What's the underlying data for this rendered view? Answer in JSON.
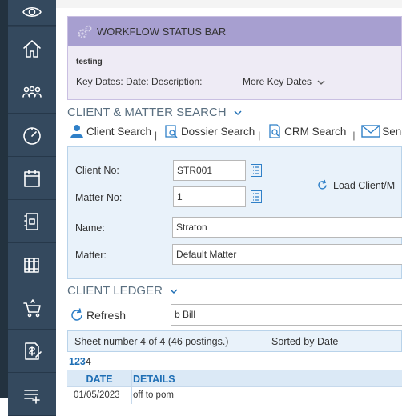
{
  "workflow": {
    "title": "WORKFLOW STATUS BAR",
    "subtitle": "testing",
    "key_dates": "Key Dates: Date:  Description:",
    "more_key_dates": "More Key Dates"
  },
  "client_search": {
    "title": "CLIENT & MATTER SEARCH",
    "links": [
      {
        "label": "Client Search",
        "icon": "person-icon"
      },
      {
        "label": "Dossier Search",
        "icon": "dossier-search-icon"
      },
      {
        "label": "CRM Search",
        "icon": "crm-search-icon"
      },
      {
        "label": "Send e",
        "icon": "email-icon"
      }
    ],
    "separator": "|",
    "client_no_label": "Client No:",
    "client_no_value": "STR001",
    "matter_no_label": "Matter No:",
    "matter_no_value": "1",
    "name_label": "Name:",
    "name_value": "Straton",
    "matter_label": "Matter:",
    "matter_value": "Default Matter",
    "load_button": "Load Client/M"
  },
  "ledger": {
    "title": "CLIENT LEDGER",
    "refresh": "Refresh",
    "bill_filter": "b Bill",
    "sheet_info": "Sheet number 4 of 4 (46 postings.)",
    "sorted_by": "Sorted by Date",
    "pages": [
      "1",
      "2",
      "3",
      "4"
    ],
    "current_page": "4",
    "columns": [
      "DATE",
      "DETAILS"
    ],
    "rows": [
      {
        "date": "01/05/2023",
        "details": "off to pom"
      }
    ]
  },
  "sidebar": {
    "items": [
      "eye-icon",
      "home-icon",
      "people-icon",
      "dashboard-icon",
      "calendar-icon",
      "document-icon",
      "library-icon",
      "cart-icon",
      "billing-icon",
      "list-add-icon"
    ]
  },
  "colors": {
    "sidebar": "#34495e",
    "workflow_header": "#a79fd0",
    "panel_bg": "#e9f2fa",
    "link_blue": "#1f6fb5"
  }
}
